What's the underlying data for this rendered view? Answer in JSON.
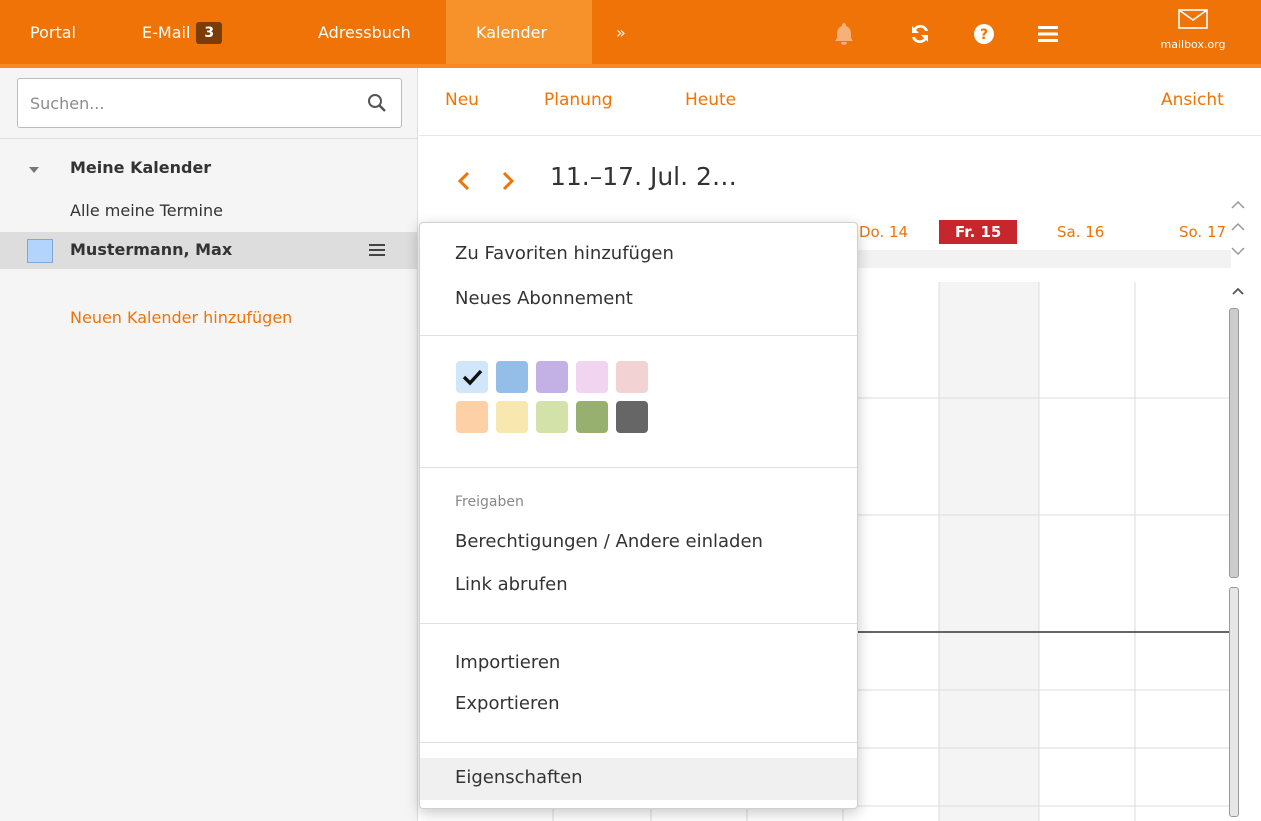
{
  "topbar": {
    "items": [
      {
        "label": "Portal"
      },
      {
        "label": "E-Mail",
        "badge": "3"
      },
      {
        "label": "Adressbuch"
      },
      {
        "label": "Kalender"
      },
      {
        "label": "»"
      }
    ],
    "logo_text": "mailbox.org",
    "icons": [
      "bell-icon",
      "refresh-icon",
      "help-icon",
      "menu-icon"
    ],
    "accent": "#ef7306"
  },
  "sidebar": {
    "search_placeholder": "Suchen...",
    "tree_title": "Meine Kalender",
    "all_label": "Alle meine Termine",
    "calendar_name": "Mustermann, Max",
    "add_calendar": "Neuen Kalender hinzufügen"
  },
  "toolbar": {
    "new": "Neu",
    "planning": "Planung",
    "today": "Heute",
    "view": "Ansicht"
  },
  "calendar": {
    "week_title": "11.–17. Jul. 2…",
    "days": [
      {
        "label": "Do. 14",
        "today": false
      },
      {
        "label": "Fr. 15",
        "today": true
      },
      {
        "label": "Sa. 16",
        "today": false
      },
      {
        "label": "So. 17",
        "today": false
      }
    ],
    "today_color": "#c8262d"
  },
  "menu": {
    "add_favorite": "Zu Favoriten hinzufügen",
    "new_subscription": "Neues Abonnement",
    "colors": [
      "#cfe6fb",
      "#94bde8",
      "#c3b0e4",
      "#f0d4f0",
      "#f2d2d2",
      "#fdd0a6",
      "#f8e8b0",
      "#d3e2a9",
      "#98b06f",
      "#666666"
    ],
    "selected_color_index": 0,
    "shares_header": "Freigaben",
    "permissions": "Berechtigungen / Andere einladen",
    "get_link": "Link abrufen",
    "import": "Importieren",
    "export": "Exportieren",
    "properties": "Eigenschaften"
  }
}
